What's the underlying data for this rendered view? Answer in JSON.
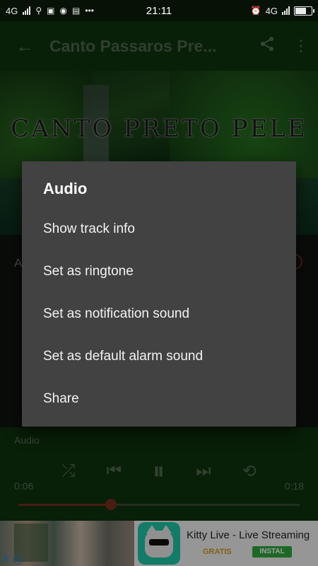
{
  "status_bar": {
    "network_left": "4G",
    "time": "21:11",
    "network_right": "4G",
    "icons_left": [
      "signal-icon",
      "usb-icon",
      "sim-icon",
      "hotspot-icon",
      "message-icon",
      "more-dots-icon"
    ],
    "icons_right": [
      "alarm-icon",
      "signal-icon",
      "battery-charging-icon"
    ],
    "battery_level": 0.7
  },
  "toolbar": {
    "title": "Canto Passaros Pre...",
    "icons": [
      "back-arrow-icon",
      "share-icon",
      "overflow-menu-icon"
    ]
  },
  "cover_art": {
    "title": "CANTO PRETO PELE"
  },
  "background_list": {
    "row_label": "A"
  },
  "player": {
    "track_label": "Audio",
    "elapsed": "0:06",
    "duration": "0:18",
    "progress": 0.33,
    "icons": [
      "shuffle-icon",
      "previous-icon",
      "pause-icon",
      "next-icon",
      "repeat-icon"
    ]
  },
  "ad": {
    "title": "Kitty Live - Live Streaming",
    "price": "GRATIS",
    "install_label": "INSTAL",
    "close_glyph": "✕",
    "info_glyph": "i"
  },
  "dialog": {
    "title": "Audio",
    "items": [
      "Show track info",
      "Set as ringtone",
      "Set as notification sound",
      "Set as default alarm sound",
      "Share"
    ]
  },
  "colors": {
    "toolbar_bg": "#0d350d",
    "dialog_bg": "#424242",
    "accent": "#e0402a",
    "install_green": "#2eaa3c"
  }
}
